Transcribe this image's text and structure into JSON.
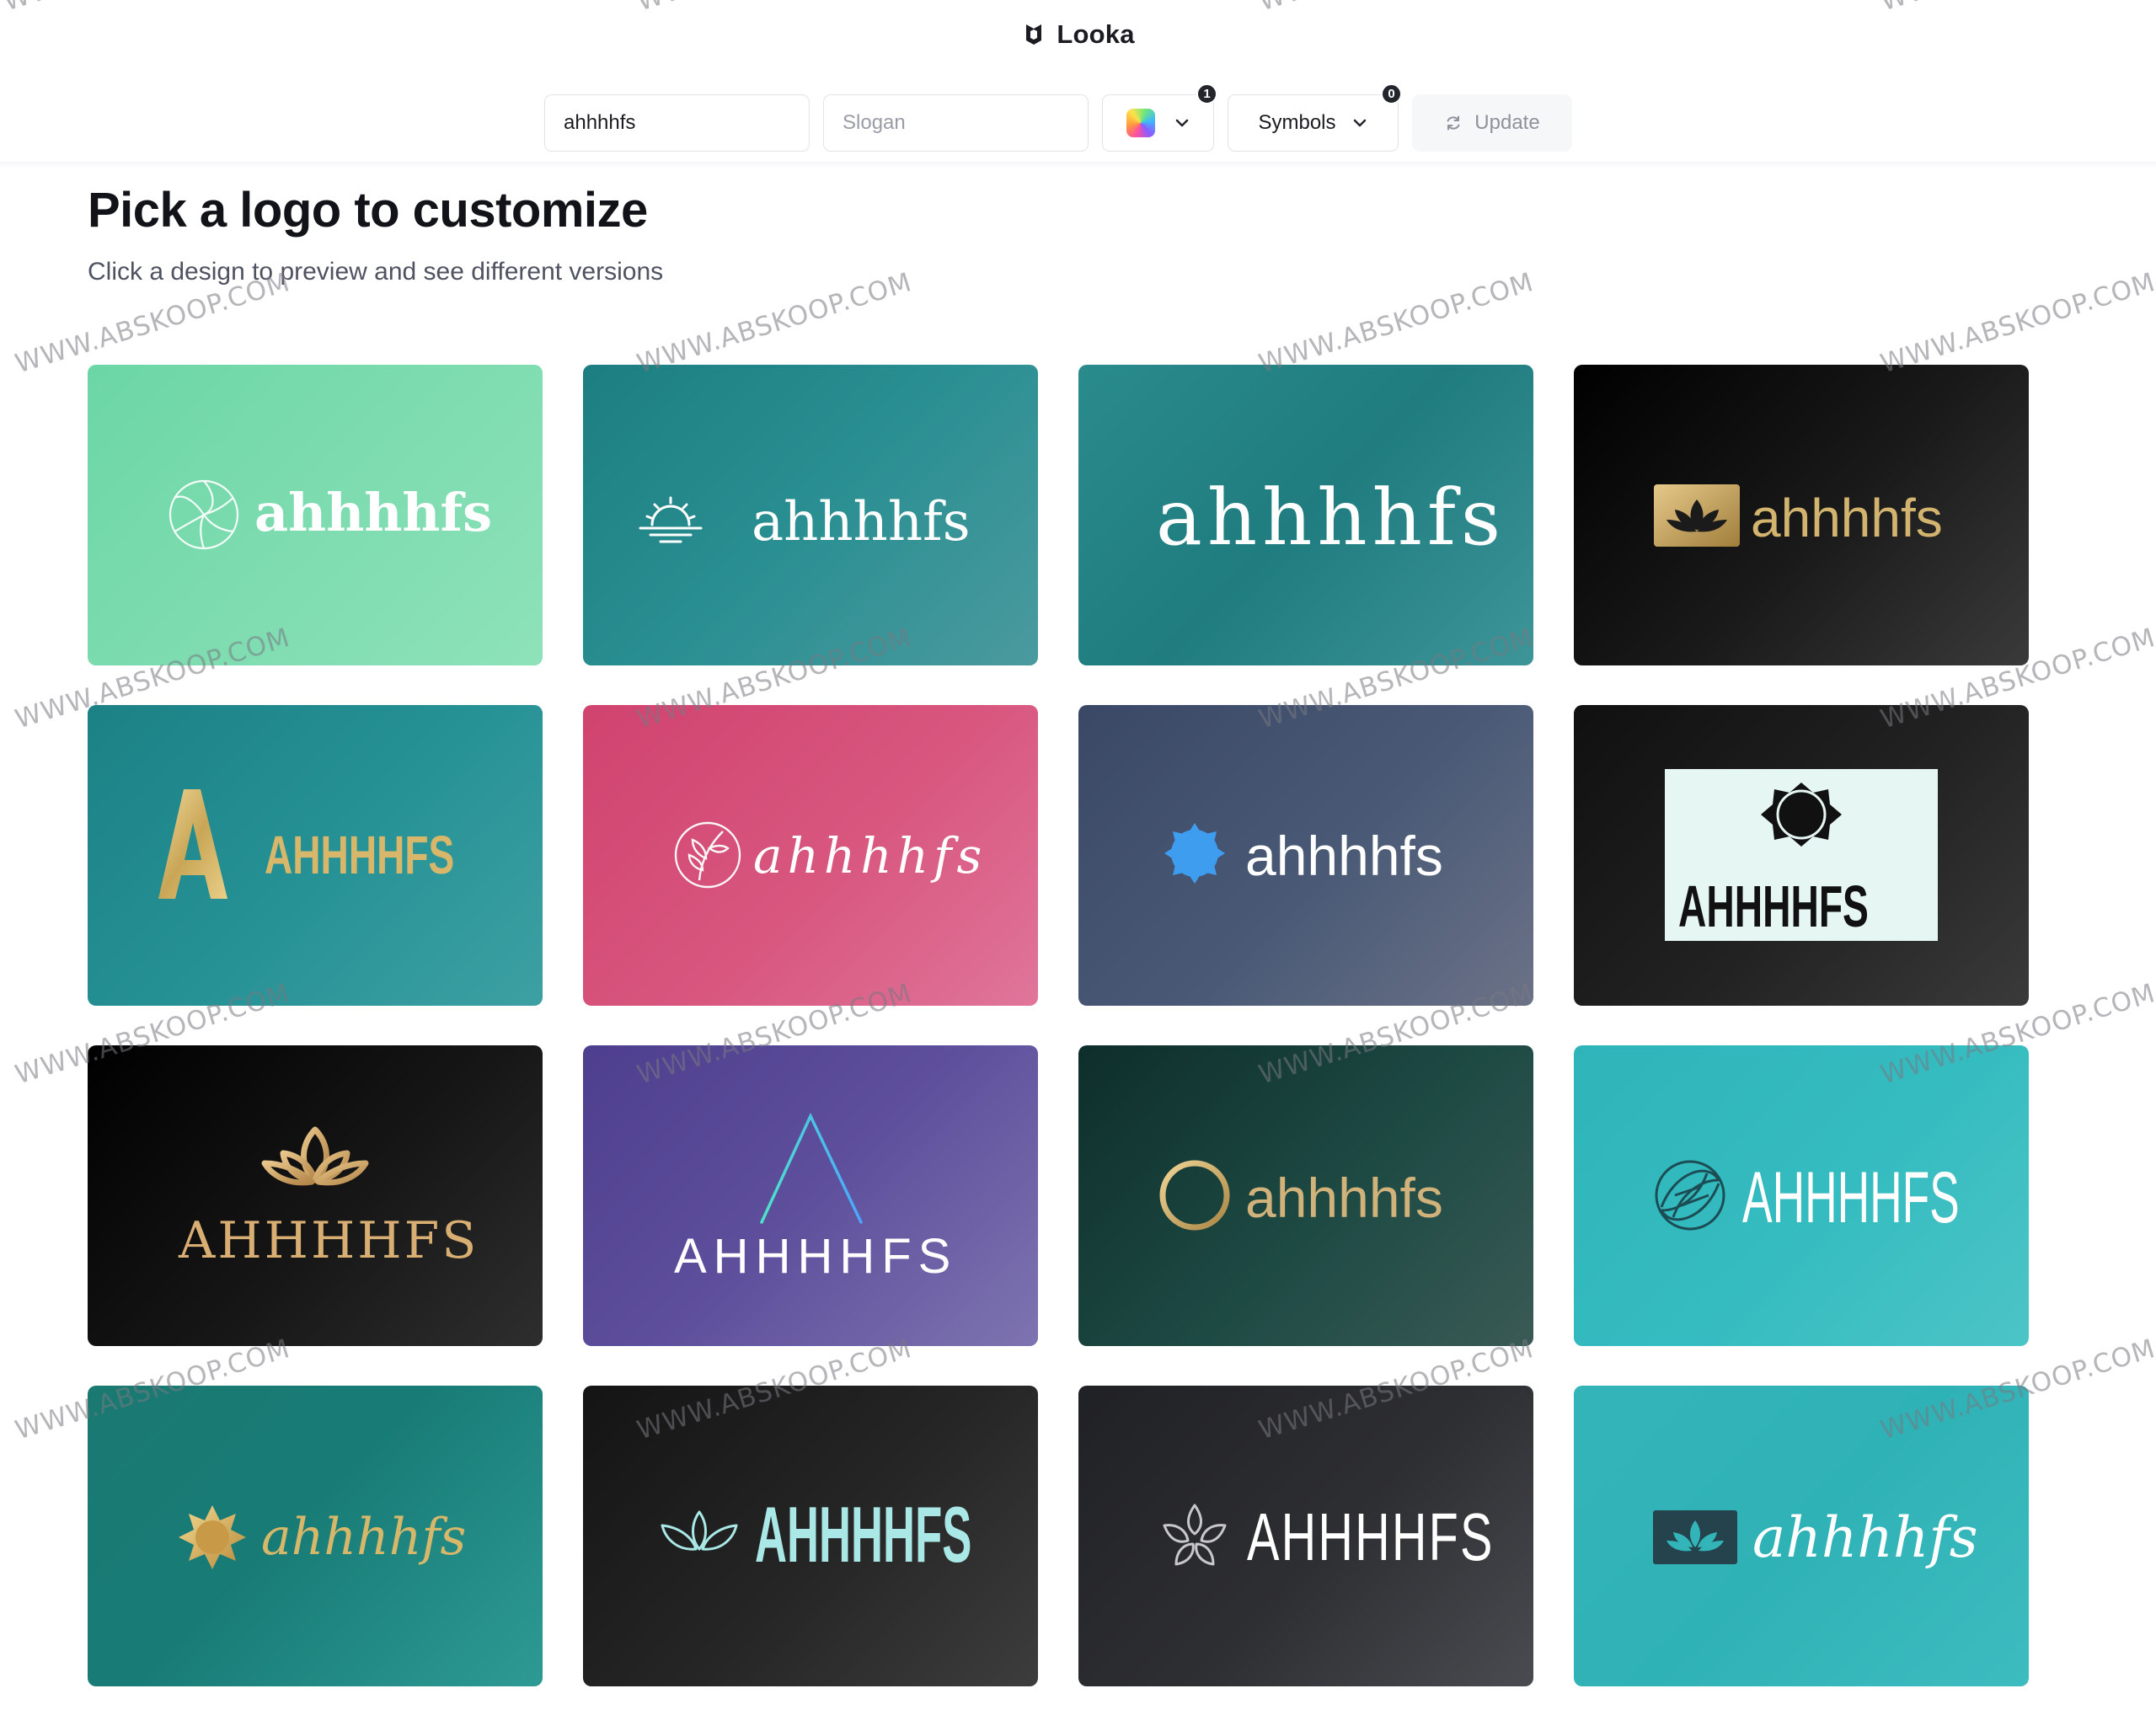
{
  "header": {
    "brand": "Looka",
    "logo_icon": "looka-logo-icon"
  },
  "toolbar": {
    "name_value": "ahhhhfs",
    "slogan_placeholder": "Slogan",
    "colors_count": "1",
    "symbols_label": "Symbols",
    "symbols_count": "0",
    "update_label": "Update"
  },
  "main": {
    "title": "Pick a logo to customize",
    "subtitle": "Click a design to preview and see different versions"
  },
  "cards": [
    {
      "wordmark": "ahhhhfs",
      "icon": "flower-swirl-icon"
    },
    {
      "wordmark": "ahhhhfs",
      "icon": "sunrise-icon"
    },
    {
      "wordmark": "ahhhhfs",
      "icon": ""
    },
    {
      "wordmark": "ahhhhfs",
      "icon": "lotus-badge-icon"
    },
    {
      "wordmark": "AHHHHFS",
      "icon": "letter-a-gold-icon"
    },
    {
      "wordmark": "ahhhhfs",
      "icon": "leaf-circle-icon"
    },
    {
      "wordmark": "ahhhhfs",
      "icon": "sun-gear-icon"
    },
    {
      "wordmark": "AHHHHFS",
      "icon": "dark-flower-icon"
    },
    {
      "wordmark": "AHHHHFS",
      "icon": "lotus-outline-icon"
    },
    {
      "wordmark": "AHHHHFS",
      "icon": "letter-a-outline-icon"
    },
    {
      "wordmark": "ahhhhfs",
      "icon": "ring-icon"
    },
    {
      "wordmark": "AHHHHFS",
      "icon": "leaf-swirl-icon"
    },
    {
      "wordmark": "ahhhhfs",
      "icon": "sun-star-icon"
    },
    {
      "wordmark": "AHHHHFS",
      "icon": "lotus-line-icon"
    },
    {
      "wordmark": "AHHHHFS",
      "icon": "flower-outline-icon"
    },
    {
      "wordmark": "ahhhhfs",
      "icon": "lotus-block-icon"
    }
  ],
  "watermark": "WWW.ABSKOOP.COM",
  "watermark_partial": "WW",
  "colors": {
    "accent": "#1b1c22",
    "badge": "#23252c"
  }
}
